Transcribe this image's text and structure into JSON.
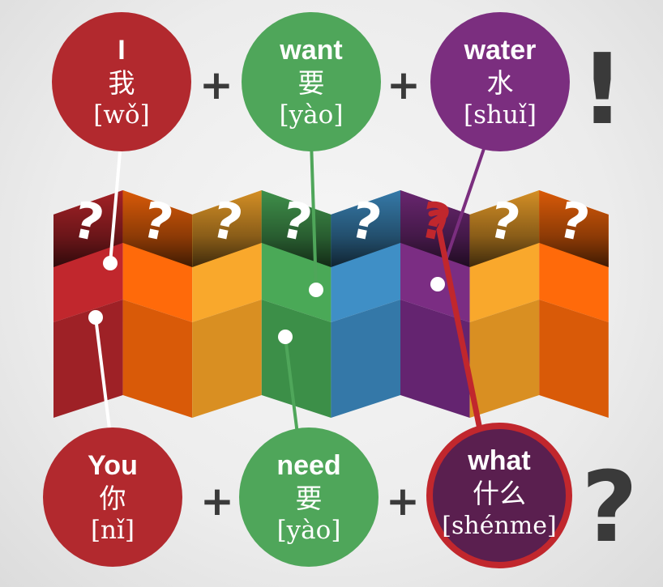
{
  "top_row": [
    {
      "word": "I",
      "hanzi": "我",
      "pinyin": "[wǒ]",
      "color": "#b2292e"
    },
    {
      "word": "want",
      "hanzi": "要",
      "pinyin": "[yào]",
      "color": "#4fa65a"
    },
    {
      "word": "water",
      "hanzi": "水",
      "pinyin": "[shuǐ]",
      "color": "#7b2e7f"
    }
  ],
  "top_end_mark": "!",
  "bottom_row": [
    {
      "word": "You",
      "hanzi": "你",
      "pinyin": "[nǐ]",
      "color": "#b2292e"
    },
    {
      "word": "need",
      "hanzi": "要",
      "pinyin": "[yào]",
      "color": "#4fa65a"
    },
    {
      "word": "what",
      "hanzi": "什么",
      "pinyin": "[shénme]",
      "color": "#5a1f4f"
    }
  ],
  "bottom_end_mark": "?",
  "operator": "+",
  "map_panels": [
    {
      "color": "#c1272d",
      "dark": "#9e2126",
      "mark": "?"
    },
    {
      "color": "#ff6a0a",
      "dark": "#d95a08",
      "mark": "?"
    },
    {
      "color": "#f9a82c",
      "dark": "#d98f22",
      "mark": "?"
    },
    {
      "color": "#4aa957",
      "dark": "#3c8f48",
      "mark": "?"
    },
    {
      "color": "#3f8fc6",
      "dark": "#3478a8",
      "mark": "?"
    },
    {
      "color": "#7b2d83",
      "dark": "#642470",
      "mark": "?"
    },
    {
      "color": "#f9a82c",
      "dark": "#d98f22",
      "mark": "?"
    },
    {
      "color": "#ff6a0a",
      "dark": "#d95a08",
      "mark": "?"
    }
  ]
}
